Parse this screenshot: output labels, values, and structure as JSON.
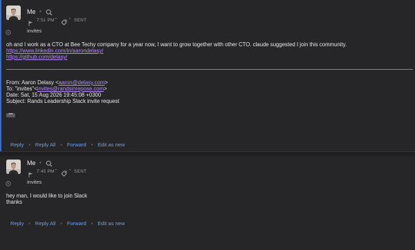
{
  "messages": [
    {
      "sender": "Me",
      "time": "7:51 PM",
      "status": "SENT",
      "subject": "invites",
      "body_lines": [
        "oh and I work as a CTO at Bee Techy company for a year now, I want to grow together with other CTO. claude suggested I join this community."
      ],
      "links": [
        "https://www.linkedin.com/in/aarondelasy/",
        "https://github.com/delasy/"
      ],
      "quoted": {
        "from_label": "From: Aaron Delasy <",
        "from_email": "aaron@delasy.com",
        "from_end": ">",
        "to_label": "To: \"invites\"<",
        "to_email": "invites@randsinrepose.com",
        "to_end": ">",
        "date": "Date: Sat, 15 Aug 2026 19:45:08 +0300",
        "subject": "Subject: Rands Leadership Slack invite request"
      },
      "ellipsis": "•••",
      "actions": [
        "Reply",
        "Reply All",
        "Forward",
        "Edit as new"
      ],
      "separator": "•"
    },
    {
      "sender": "Me",
      "time": "7:45 PM",
      "status": "SENT",
      "subject": "invites",
      "body_lines": [
        "hey man, I would like to join Slack",
        "thanks"
      ],
      "actions": [
        "Reply",
        "Reply All",
        "Forward",
        "Edit as new"
      ],
      "separator": "•"
    }
  ],
  "header_separator": "•",
  "colors": {
    "background": "#262628",
    "accent_bar": "#2f6fe0",
    "link": "#b58cf5",
    "action": "#6aa0f0"
  }
}
